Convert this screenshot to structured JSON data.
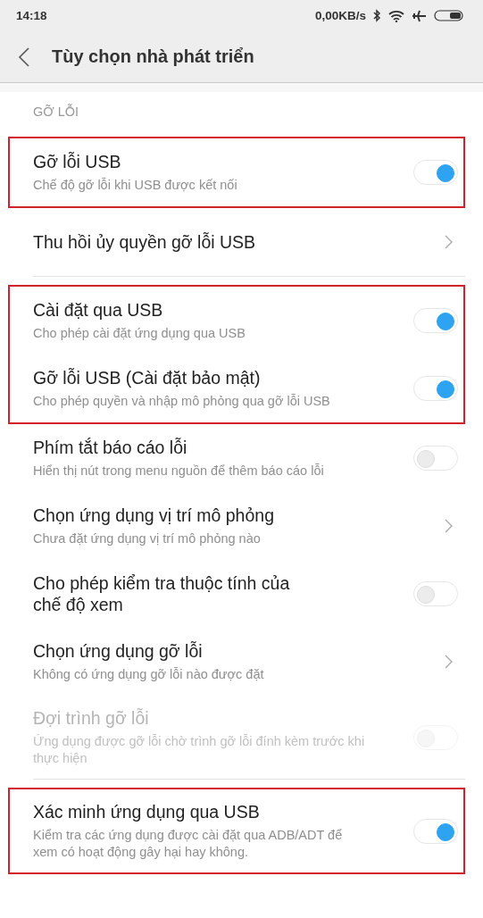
{
  "status_bar": {
    "time": "14:18",
    "speed": "0,00KB/s"
  },
  "header": {
    "title": "Tùy chọn nhà phát triển"
  },
  "section": {
    "label": "GỠ LỖI"
  },
  "blocks": [
    {
      "highlighted": true,
      "rows": [
        {
          "kind": "toggle",
          "title": "Gỡ lỗi USB",
          "subtitle": "Chế độ gỡ lỗi khi USB được kết nối",
          "on": true,
          "disabled": false
        }
      ]
    },
    {
      "highlighted": false,
      "rows": [
        {
          "kind": "nav",
          "title": "Thu hồi ủy quyền gỡ lỗi USB"
        }
      ]
    },
    {
      "highlighted": true,
      "rows": [
        {
          "kind": "toggle",
          "title": "Cài đặt qua USB",
          "subtitle": "Cho phép cài đặt ứng dụng qua USB",
          "on": true,
          "disabled": false
        },
        {
          "kind": "toggle",
          "title": "Gỡ lỗi USB (Cài đặt bảo mật)",
          "subtitle": "Cho phép quyền và nhập mô phỏng qua gỡ lỗi USB",
          "on": true,
          "disabled": false
        }
      ]
    },
    {
      "highlighted": false,
      "rows": [
        {
          "kind": "toggle",
          "title": "Phím tắt báo cáo lỗi",
          "subtitle": "Hiển thị nút trong menu nguồn để thêm báo cáo lỗi",
          "on": false,
          "disabled": false
        },
        {
          "kind": "nav",
          "title": "Chọn ứng dụng vị trí mô phỏng",
          "subtitle": "Chưa đặt ứng dụng vị trí mô phỏng nào"
        },
        {
          "kind": "toggle",
          "title": "Cho phép kiểm tra thuộc tính của chế độ xem",
          "on": false,
          "disabled": false
        },
        {
          "kind": "nav",
          "title": "Chọn ứng dụng gỡ lỗi",
          "subtitle": "Không có ứng dụng gỡ lỗi nào được đặt"
        },
        {
          "kind": "toggle",
          "title": "Đợi trình gỡ lỗi",
          "subtitle": "Ứng dụng được gỡ lỗi chờ trình gỡ lỗi đính kèm trước khi thực hiện",
          "on": false,
          "disabled": true
        }
      ]
    },
    {
      "highlighted": true,
      "rows": [
        {
          "kind": "toggle",
          "title": "Xác minh ứng dụng qua USB",
          "subtitle": "Kiểm tra các ứng dụng được cài đặt qua ADB/ADT để xem có hoạt động gây hại hay không.",
          "on": true,
          "disabled": false
        }
      ]
    }
  ]
}
